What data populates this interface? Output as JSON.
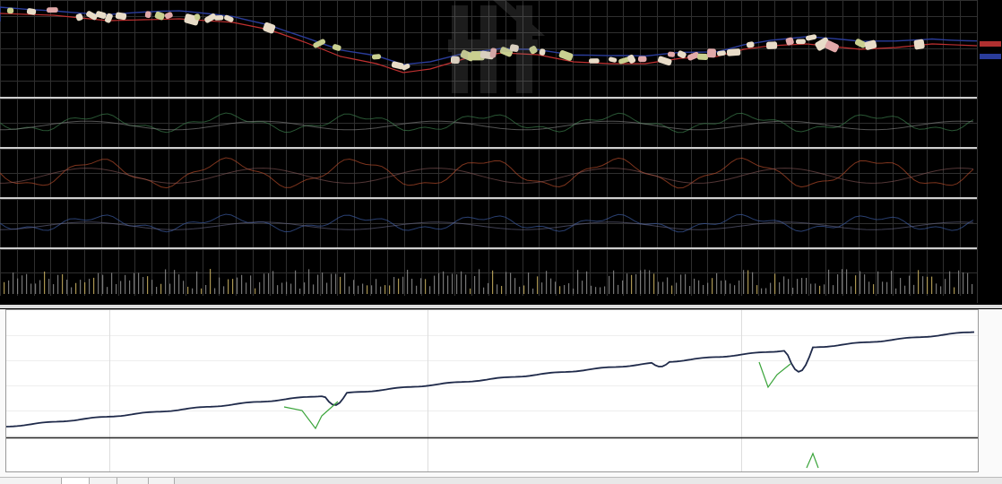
{
  "colors": {
    "grid": "#2f2f2f",
    "ma_red": "#c03030",
    "ma_blue": "#2a3c9a",
    "candle_cream": "#e8dcc8",
    "candle_olive": "#c9cf90",
    "candle_pink": "#e1a9a9",
    "equity": "#1f2a4a",
    "drawdown": "#3aa43a",
    "bg_dark": "#000000",
    "bg_light": "#ffffff"
  },
  "icons": {
    "watermark": "trading-platform-watermark-icon"
  }
}
